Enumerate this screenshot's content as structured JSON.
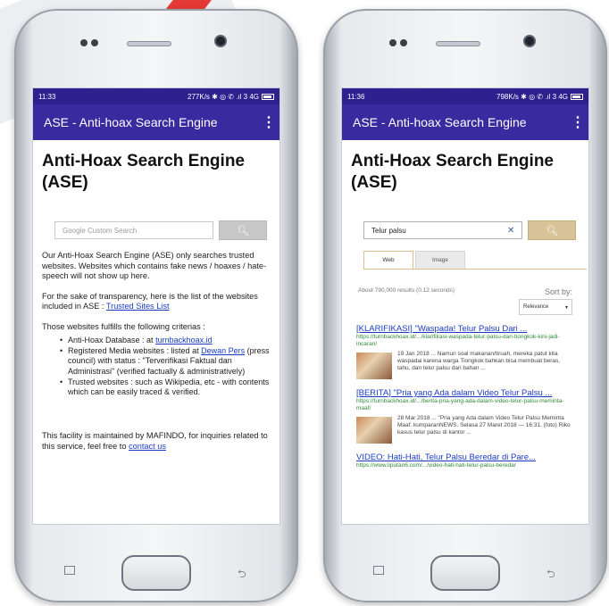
{
  "left_phone": {
    "status": {
      "time": "11:33",
      "right": "277K/s ✱ ◎ ✆ .ıl 3 4G"
    },
    "app_bar": {
      "title": "ASE - Anti-hoax Search Engine",
      "menu": "⋮"
    },
    "page_title": "Anti-Hoax Search Engine (ASE)",
    "search": {
      "placeholder": "Google Custom Search"
    },
    "intro": "Our Anti-Hoax Search Engine (ASE) only searches trusted websites. Websites which contains fake news / hoaxes / hate-speech will not show up here.",
    "transparency_text": "For the sake of transparency, here is the list of the websites included in ASE : ",
    "transparency_link": "Trusted Sites List",
    "criteria_heading": "Those websites fulfills the following criterias :",
    "criteria": [
      {
        "text": "Anti-Hoax Database : at ",
        "link": "turnbackhoax.id",
        "rest": ""
      },
      {
        "text": "Registered Media websites : listed at ",
        "link": "Dewan Pers",
        "rest": " (press council) with status : \"Terverifikasi Faktual dan Administrasi\" (verified factually & administratively)"
      },
      {
        "text": "Trusted websites : such as Wikipedia, etc - with contents which can be easily traced & verified.",
        "link": "",
        "rest": ""
      }
    ],
    "footer_text": "This facility is maintained by MAFINDO, for inquiries related to this service, feel free to ",
    "footer_link": "contact us"
  },
  "right_phone": {
    "status": {
      "time": "11:36",
      "right": "798K/s ✱ ◎ ✆ .ıl 3 4G"
    },
    "app_bar": {
      "title": "ASE - Anti-hoax Search Engine",
      "menu": "⋮"
    },
    "page_title": "Anti-Hoax Search Engine (ASE)",
    "search": {
      "value": "Telur palsu",
      "clear": "✕"
    },
    "tabs": [
      "Web",
      "Image"
    ],
    "result_count": "About 790,000 results (0.12 seconds)",
    "sort_label": "Sort by:",
    "sort_value": "Relevance",
    "results": [
      {
        "title": "[KLARIFIKASI] \"Waspada! Telur Palsu Dari ...",
        "url": "https://turnbackhoax.id/.../klarifikasi-waspada-telur-palsu-dari-tiongkok-kini-jadi-incaran/",
        "snippet": "19 Jan 2018 ... Namun soal makanan/tiruah, mereka patut kita waspadai karena warga Tiongkok bahkan bisa membuat beras, tahu, dan telur palsu dari bahan ..."
      },
      {
        "title": "[BERITA] \"Pria yang Ada dalam Video Telur Palsu ...",
        "url": "https://turnbackhoax.id/.../berita-pria-yang-ada-dalam-video-telur-palsu-meminta-maaf/",
        "snippet": "28 Mar 2018 ... \"Pria yang Ada dalam Video Telur Palsu Meminta Maaf. kumparanNEWS. Selasa 27 Maret 2018 — 16:31. (foto) Riko kasus telur palsu di kantor ..."
      },
      {
        "title": "VIDEO: Hati-Hati, Telur Palsu Beredar di Pare...",
        "url": "https://www.liputan6.com/.../video-hati-hati-telur-palsu-beredar",
        "snippet": ""
      }
    ]
  }
}
